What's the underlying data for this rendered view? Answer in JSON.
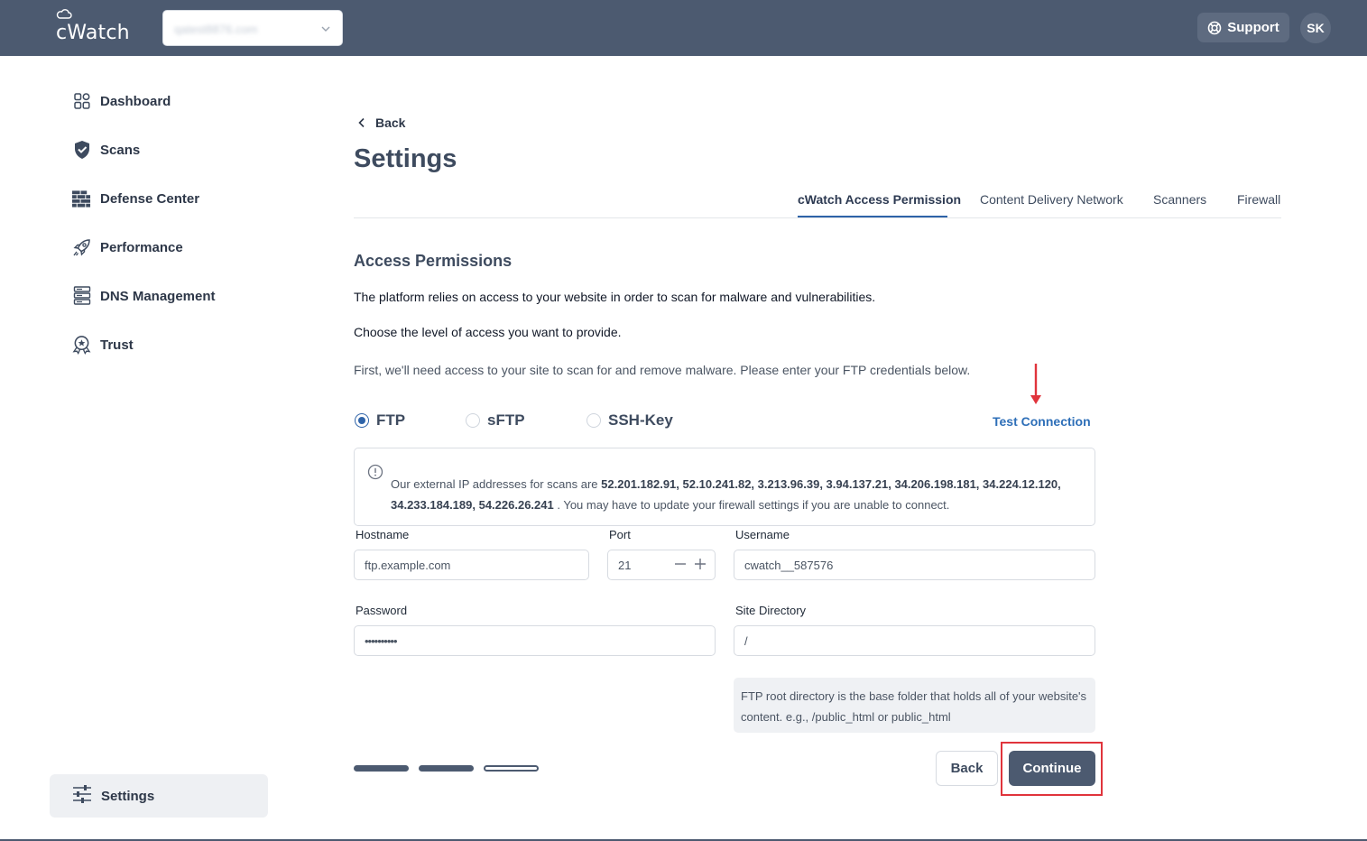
{
  "app": {
    "logo": "cWatch"
  },
  "header": {
    "domain_select_value": "qatest8876.com",
    "support_label": "Support",
    "avatar_initials": "SK"
  },
  "sidebar": {
    "items": [
      {
        "label": "Dashboard",
        "icon": "dashboard-icon"
      },
      {
        "label": "Scans",
        "icon": "shield-check-icon"
      },
      {
        "label": "Defense Center",
        "icon": "firewall-icon"
      },
      {
        "label": "Performance",
        "icon": "rocket-icon"
      },
      {
        "label": "DNS Management",
        "icon": "server-icon"
      },
      {
        "label": "Trust",
        "icon": "trust-badge-icon"
      }
    ],
    "settings_label": "Settings"
  },
  "main": {
    "back_label": "Back",
    "title": "Settings",
    "tabs": [
      {
        "label": "cWatch Access Permission",
        "active": true
      },
      {
        "label": "Content Delivery Network",
        "active": false
      },
      {
        "label": "Scanners",
        "active": false
      },
      {
        "label": "Firewall",
        "active": false
      }
    ],
    "section_title": "Access Permissions",
    "para1": "The platform relies on access to your website in order to scan for malware and vulnerabilities.",
    "para2": "Choose the level of access you want to provide.",
    "para3": "First, we'll need access to your site to scan for and remove malware. Please enter your FTP credentials below.",
    "protocols": [
      {
        "label": "FTP",
        "checked": true
      },
      {
        "label": "sFTP",
        "checked": false
      },
      {
        "label": "SSH-Key",
        "checked": false
      }
    ],
    "test_connection_label": "Test Connection",
    "info": {
      "prefix": "Our external IP addresses for scans are ",
      "ips_line1": "52.201.182.91, 52.10.241.82, 3.213.96.39, 3.94.137.21, 34.206.198.181, 34.224.12.120,",
      "ips_line2": "34.233.184.189, 54.226.26.241",
      "suffix": " . You may have to update your firewall settings if you are unable to connect."
    },
    "form": {
      "hostname_label": "Hostname",
      "hostname_placeholder": "ftp.example.com",
      "port_label": "Port",
      "port_value": "21",
      "username_label": "Username",
      "username_value": "cwatch__587576",
      "password_label": "Password",
      "password_value": "••••••••••",
      "site_dir_label": "Site Directory",
      "site_dir_value": "/",
      "site_dir_hint": "FTP root directory is the base folder that holds all of your website's content. e.g., /public_html or public_html"
    },
    "progress": {
      "steps_total": 3,
      "steps_completed": 2
    },
    "back_button_label": "Back",
    "continue_button_label": "Continue"
  },
  "colors": {
    "header_bg": "#4c5a70",
    "accent_blue": "#2e63a8",
    "link_blue": "#2e6fb8",
    "highlight_red": "#e0343c"
  }
}
